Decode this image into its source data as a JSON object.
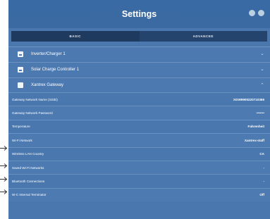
{
  "window": {
    "title": "Settings"
  },
  "tabs": [
    {
      "label": "BASIC",
      "active": true
    },
    {
      "label": "ADVANCED",
      "active": false
    }
  ],
  "devices": [
    {
      "label": "Inverter/Charger 1",
      "icon": "inverter-icon",
      "expanded": false
    },
    {
      "label": "Solar Charge Controller 1",
      "icon": "solar-controller-icon",
      "expanded": false
    },
    {
      "label": "Xantrex Gateway",
      "icon": "gateway-icon",
      "expanded": true
    }
  ],
  "gateway_settings": [
    {
      "label": "Gateway Network Name (SSID)",
      "value": "XGW9900220710366"
    },
    {
      "label": "Gateway Network Password",
      "value": "•••••••"
    },
    {
      "label": "Temperature",
      "value": "Fahrenheit"
    },
    {
      "label": "Wi-Fi Network",
      "value": "Xantrex-staff"
    },
    {
      "label": "Wireless LAN Country",
      "value": "CA"
    },
    {
      "label": "Saved Wi-Fi Networks",
      "value": "-"
    },
    {
      "label": "Bluetooth Connections",
      "value": "-"
    },
    {
      "label": "W-C Internal Terminator",
      "value": "Off"
    }
  ],
  "colors": {
    "background": "#4a77ae",
    "titlebar": "#3b6aa2",
    "tab_active": "#1e3a5f",
    "tab_inactive": "#24446e"
  }
}
